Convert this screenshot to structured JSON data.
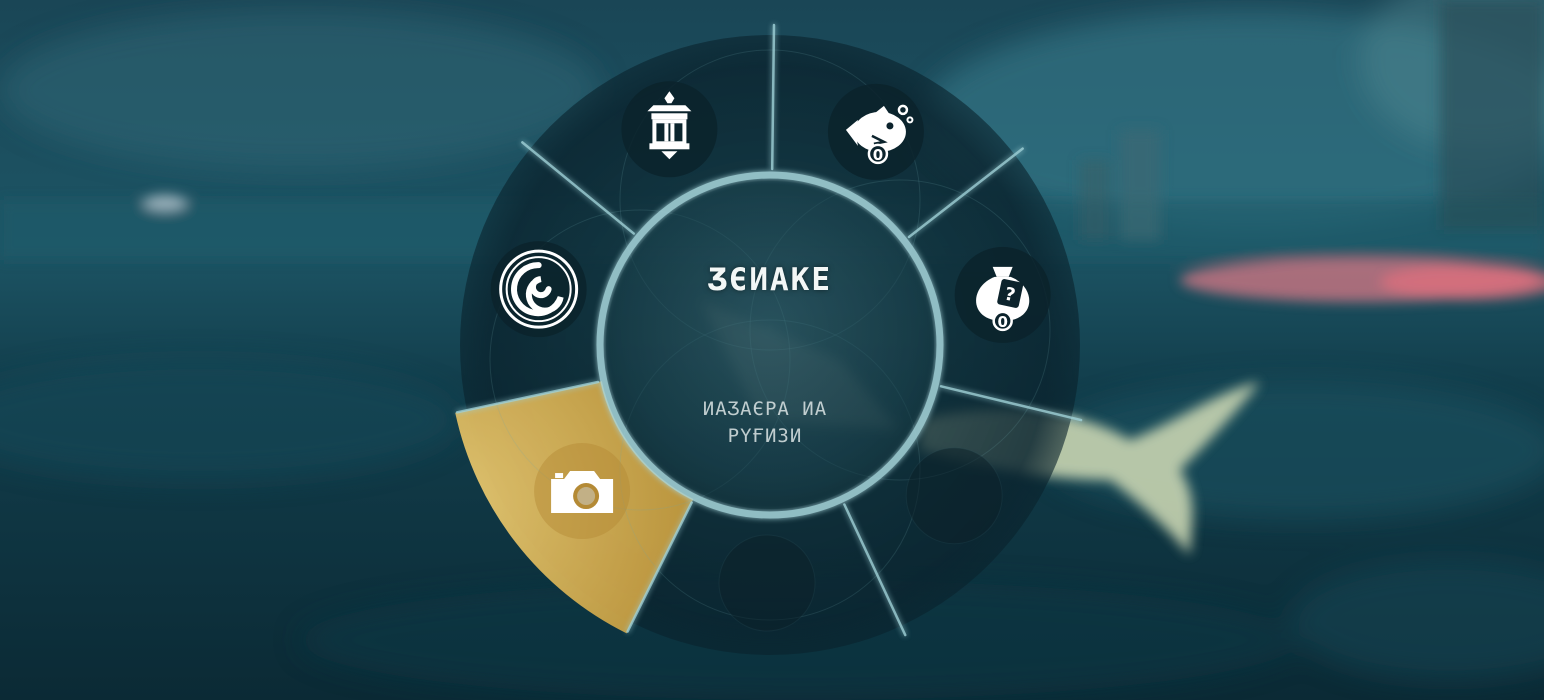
{
  "radial_menu": {
    "title": "ƷЄИАКЕ",
    "selected_description": "ИАƷАЄРА ИА\nРҮҒИЗИ",
    "accent_color": "#e2bd5e",
    "slots": [
      {
        "name": "lantern-slot",
        "icon": "lantern-shrine-icon",
        "state": "normal"
      },
      {
        "name": "fish-bait-slot",
        "icon": "fish-bait-icon",
        "count": "0",
        "state": "normal"
      },
      {
        "name": "mystery-bag-slot",
        "icon": "mystery-bag-icon",
        "count": "0",
        "state": "normal"
      },
      {
        "name": "empty-slot-right",
        "icon": "empty-slot-icon",
        "state": "empty"
      },
      {
        "name": "empty-slot-bottom",
        "icon": "empty-slot-icon",
        "state": "empty"
      },
      {
        "name": "camera-slot",
        "icon": "camera-icon",
        "state": "selected"
      },
      {
        "name": "spiral-slot",
        "icon": "spiral-orb-icon",
        "state": "normal"
      }
    ]
  }
}
